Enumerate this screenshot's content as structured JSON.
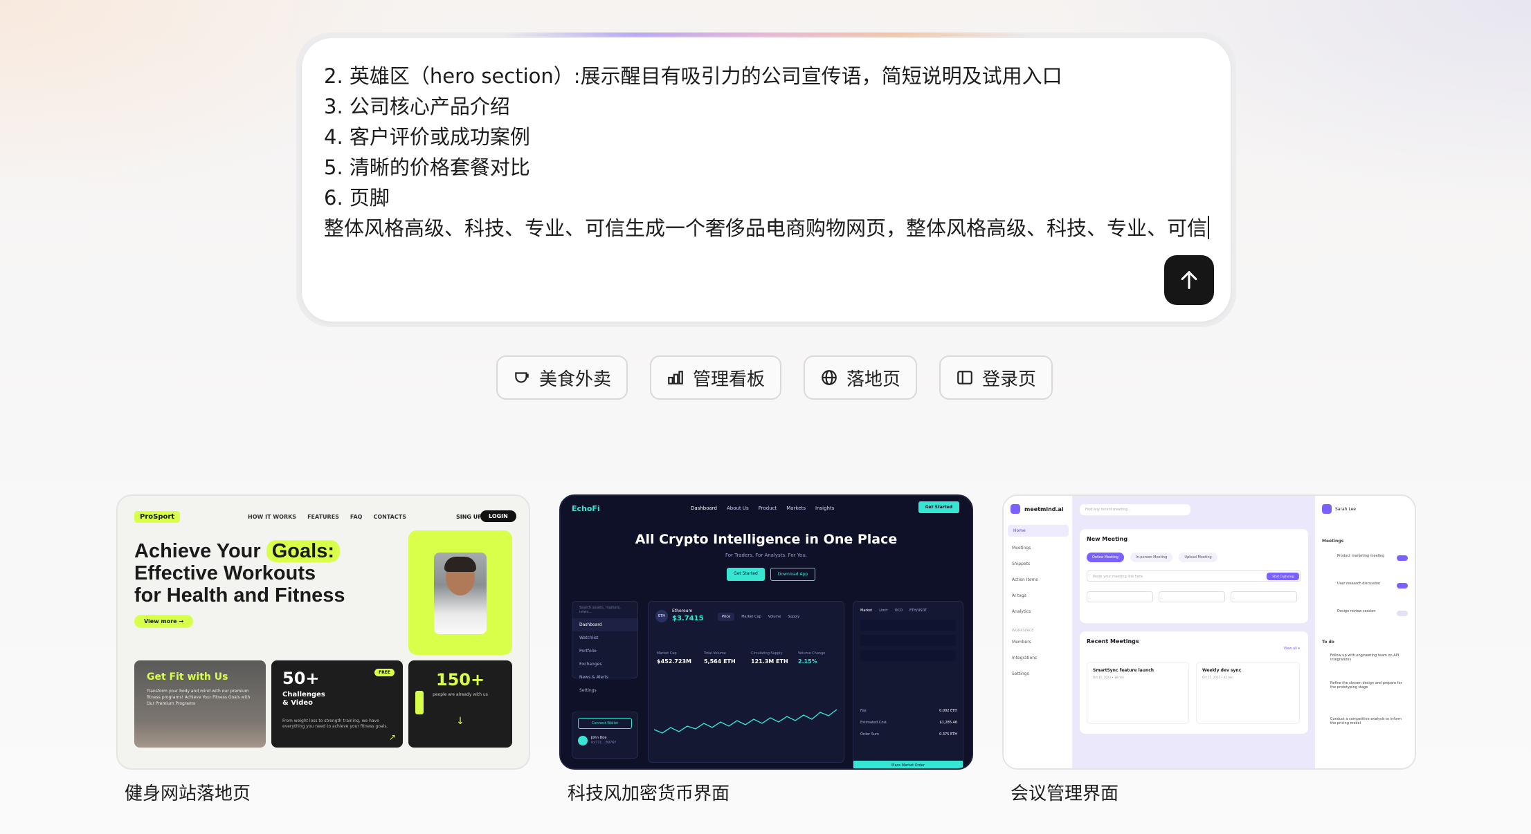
{
  "prompt": {
    "lines": [
      "2. 英雄区（hero section）:展示醒目有吸引力的公司宣传语，简短说明及试用入口",
      "3. 公司核心产品介绍",
      "4. 客户评价或成功案例",
      "5. 清晰的价格套餐对比",
      "6. 页脚",
      "整体风格高级、科技、专业、可信生成一个奢侈品电商购物网页，整体风格高级、科技、专业、可信"
    ],
    "send_icon": "arrow-up-icon"
  },
  "chips": [
    {
      "label": "美食外卖",
      "icon": "cup-icon"
    },
    {
      "label": "管理看板",
      "icon": "bar-chart-icon"
    },
    {
      "label": "落地页",
      "icon": "globe-icon"
    },
    {
      "label": "登录页",
      "icon": "sidebar-layout-icon"
    }
  ],
  "cards": [
    {
      "label": "健身网站落地页",
      "preview": {
        "logo": "ProSport",
        "nav": [
          "HOW IT WORKS",
          "FEATURES",
          "FAQ",
          "CONTACTS"
        ],
        "signup": "SING UP",
        "login": "LOGIN",
        "headline_1": "Achieve Your",
        "headline_hl": "Goals:",
        "headline_2": "Effective Workouts",
        "headline_3": "for Health and Fitness",
        "view_more": "View more →",
        "box1_title": "Get Fit with Us",
        "box1_text": "Transform your body and mind with our premium fitness programs! Achieve Your Fitness Goals with Our Premium Programs",
        "box2_num": "50+",
        "box2_label_1": "Challenges",
        "box2_label_2": "& Video",
        "box2_free": "FREE",
        "box2_text": "From weight loss to strength training, we have everything you need to achieve your fitness goals.",
        "box2_arrow": "↗",
        "box3_num": "150+",
        "box3_text": "people are already with us",
        "box3_arrow": "↓",
        "accent": "#d8ff4a"
      }
    },
    {
      "label": "科技风加密货币界面",
      "preview": {
        "logo": "EchoFi",
        "nav": [
          "Dashboard",
          "About Us",
          "Product",
          "Markets",
          "Insights"
        ],
        "cta": "Get Started",
        "headline": "All Crypto Intelligence in One Place",
        "sub": "For Traders. For Analysts. For You.",
        "btn1": "Get Started",
        "btn2": "Download App",
        "search": "Search assets, markets, news...",
        "side": [
          "Dashboard",
          "Watchlist",
          "Portfolio",
          "Exchanges",
          "News & Alerts",
          "Settings"
        ],
        "connect": "Connect Wallet",
        "user_name": "John Doe",
        "user_sub": "0x71C...8976F",
        "coin_badge": "ETH",
        "coin": "Ethereum",
        "price": "$3.7415",
        "tabs": [
          "Price",
          "Market Cap",
          "Volume",
          "Supply"
        ],
        "stats": [
          {
            "k": "Market Cap",
            "v": "$452.723M"
          },
          {
            "k": "Total Volume",
            "v": "5,564 ETH"
          },
          {
            "k": "Circulating Supply",
            "v": "121.3M ETH"
          },
          {
            "k": "Volume Change",
            "v": "2.15%"
          }
        ],
        "order_tabs": [
          "Market",
          "Limit",
          "OCO",
          "ETH/USDT"
        ],
        "order_rows": [
          {
            "k": "Fee",
            "v": "0.002 ETH"
          },
          {
            "k": "Estimated Cost",
            "v": "$1,285.46"
          },
          {
            "k": "Order Sum",
            "v": "0.375 ETH"
          }
        ],
        "place_order": "Place Market Order",
        "accent": "#36e5d2"
      }
    },
    {
      "label": "会议管理界面",
      "preview": {
        "brand": "meetmind.ai",
        "menu": [
          "Home",
          "Meetings",
          "Snippets",
          "Action Items",
          "AI tags",
          "Analytics"
        ],
        "workspace": "WORKSPACE",
        "menu2": [
          "Members",
          "Integrations",
          "Settings"
        ],
        "search": "Find any recent meeting...",
        "new_meeting": "New Meeting",
        "pills": [
          "Online Meeting",
          "In-person Meeting",
          "Upload Meeting"
        ],
        "meeting_link": "Paste your meeting link here",
        "start_btn": "Start Capturing",
        "recent": "Recent Meetings",
        "view_all": "View all ▾",
        "m1_title": "SmartSync feature launch",
        "m1_date": "Oct 15, 2023 • 38 min",
        "m2_title": "Weekly dev sync",
        "m2_date": "Oct 15, 2023 • 42 min",
        "user": "Sarah Lee",
        "meetings_title": "Meetings",
        "meetings": [
          "Product marketing meeting",
          "User research discussion",
          "Design review session"
        ],
        "todo_title": "To do",
        "todos": [
          "Follow up with engineering team on API integrations",
          "Refine the chosen design and prepare for the prototyping stage",
          "Conduct a competitive analysis to inform the pricing model"
        ],
        "accent": "#7b61ff"
      }
    }
  ]
}
